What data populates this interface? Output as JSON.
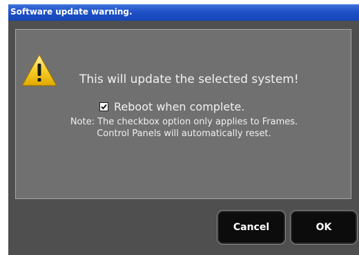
{
  "window": {
    "title": "Software update warning."
  },
  "dialog": {
    "icon": "warning-triangle-icon",
    "message": "This will update the selected system!",
    "reboot_checkbox": {
      "label": "Reboot when complete.",
      "checked": true
    },
    "note_line1": "Note: The checkbox option only applies to Frames.",
    "note_line2": "Control Panels will automatically reset."
  },
  "buttons": {
    "cancel_label": "Cancel",
    "ok_label": "OK"
  },
  "colors": {
    "titlebar": "#1f50c6",
    "window_bg": "#4f4f4f",
    "panel_bg": "#707070",
    "button_bg": "#0c0c0c",
    "warning_yellow": "#f5c518"
  }
}
